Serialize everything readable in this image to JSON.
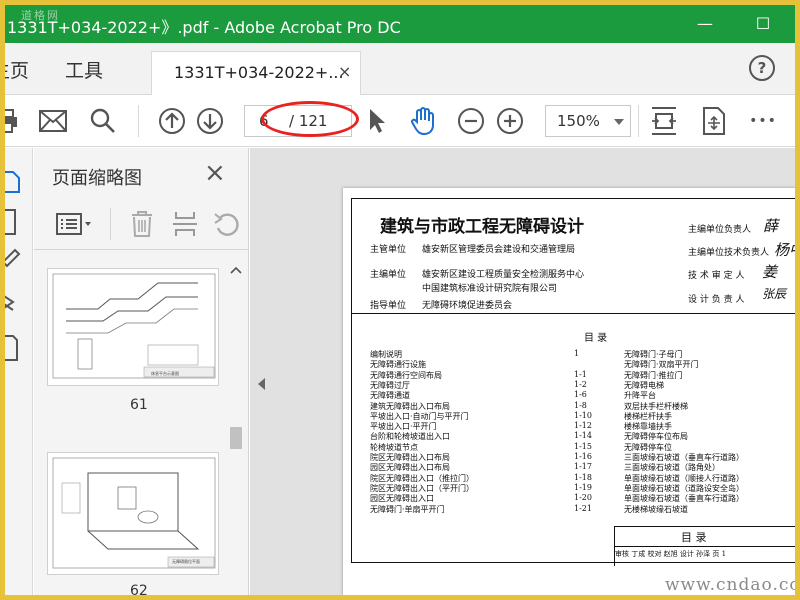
{
  "window": {
    "title": "1331T+034-2022+》.pdf - Adobe Acrobat Pro DC",
    "watermark": "道格网",
    "minimize": "—",
    "maximize": "☐"
  },
  "tabs": {
    "home": "主页",
    "tools": "工具",
    "document": "1331T+034-2022+...",
    "close": "×",
    "help": "?"
  },
  "toolbar": {
    "current_page": "6",
    "total_pages": "/ 121",
    "zoom": "150%",
    "more": "•••"
  },
  "thumbnails": {
    "header": "页面缩略图",
    "close": "×",
    "pages": [
      {
        "number": "61",
        "caption": "休息平台示意图"
      },
      {
        "number": "62",
        "caption": "无障碍厕位平面"
      }
    ]
  },
  "document": {
    "title": "建筑与市政工程无障碍设计",
    "rows": [
      {
        "label": "主管单位",
        "value": "雄安新区管理委员会建设和交通管理局"
      },
      {
        "label": "主编单位",
        "value": "雄安新区建设工程质量安全检测服务中心"
      },
      {
        "label": "",
        "value": "中国建筑标准设计研究院有限公司"
      },
      {
        "label": "指导单位",
        "value": "无障碍环境促进委员会"
      }
    ],
    "roles": [
      {
        "role": "主编单位负责人",
        "sig": "薛"
      },
      {
        "role": "主编单位技术负责人",
        "sig": "杨中"
      },
      {
        "role": "技 术 审 定 人",
        "sig": "姜"
      },
      {
        "role": "设 计 负 责 人",
        "sig": "张辰"
      }
    ],
    "toc_heading": "目    录",
    "toc_left": [
      {
        "text": "编制说明",
        "page": "1"
      },
      {
        "text": "无障碍通行设施",
        "page": ""
      },
      {
        "text": "无障碍通行空间布局",
        "page": "1-1"
      },
      {
        "text": "无障碍过厅",
        "page": "1-2"
      },
      {
        "text": "无障碍通道",
        "page": "1-6"
      },
      {
        "text": "建筑无障碍出入口布局",
        "page": "1-8"
      },
      {
        "text": "平坡出入口·自动门与平开门",
        "page": "1-10"
      },
      {
        "text": "平坡出入口·平开门",
        "page": "1-12"
      },
      {
        "text": "台阶和轮椅坡道出入口",
        "page": "1-14"
      },
      {
        "text": "轮椅坡道节点",
        "page": "1-15"
      },
      {
        "text": "院区无障碍出入口布局",
        "page": "1-16"
      },
      {
        "text": "园区无障碍出入口布局",
        "page": "1-17"
      },
      {
        "text": "院区无障碍出入口（推拉门）",
        "page": "1-18"
      },
      {
        "text": "院区无障碍出入口（平开门）",
        "page": "1-19"
      },
      {
        "text": "园区无障碍出入口",
        "page": "1-20"
      },
      {
        "text": "无障碍门·单扇平开门",
        "page": "1-21"
      }
    ],
    "toc_right": [
      "无障碍门·子母门",
      "无障碍门·双扇平开门",
      "无障碍门·推拉门",
      "无障碍电梯",
      "升降平台",
      "双层扶手栏杆楼梯",
      "楼梯栏杆扶手",
      "楼梯靠墙扶手",
      "无障碍停车位布局",
      "无障碍停车位",
      "三面坡缘石坡道（垂直车行道路）",
      "三面坡缘石坡道（路角处）",
      "单面坡缘石坡道（顺接人行道路）",
      "单面坡缘石坡道（道路设安全岛）",
      "单面坡缘石坡道（垂直车行道路）",
      "无楼梯坡缘石坡道"
    ],
    "bottom_box": "目  录",
    "bottom_strip": "审核 丁成  校对 赵旭  设计 孙泽  页 1",
    "site_watermark": "www.cndao.com"
  }
}
